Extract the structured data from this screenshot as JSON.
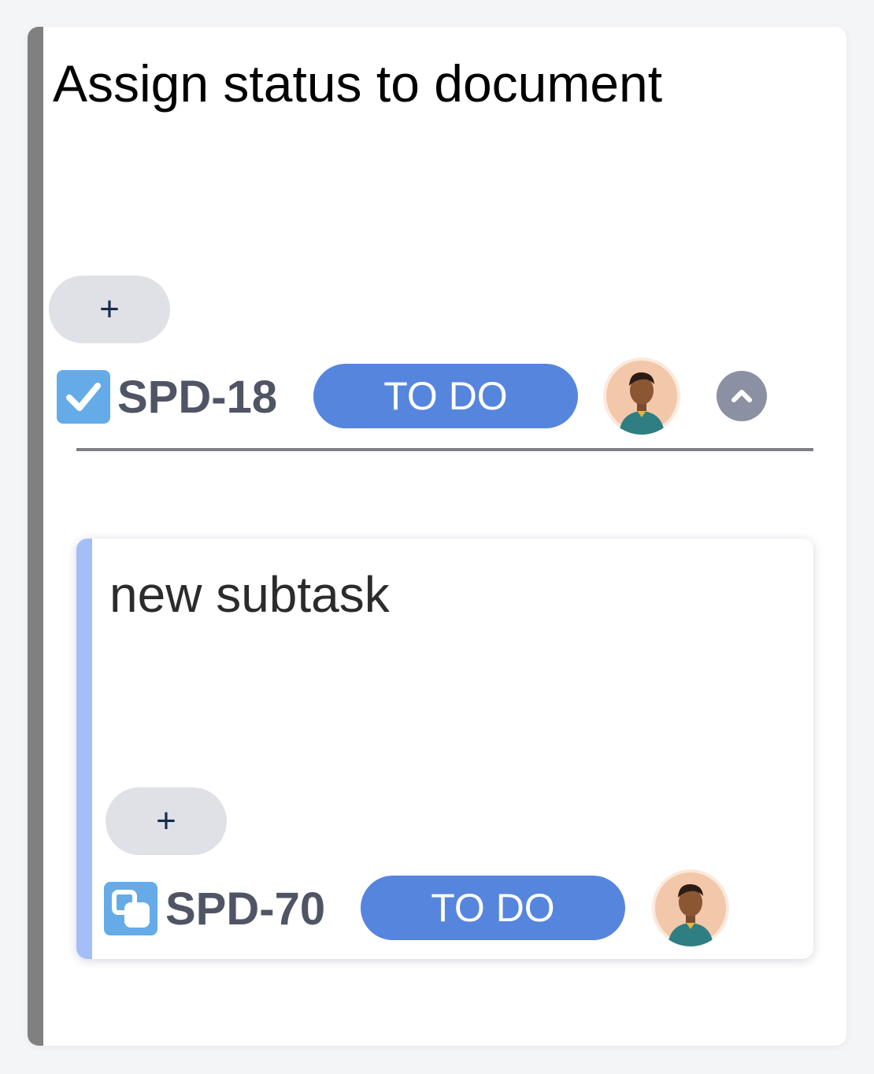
{
  "card": {
    "title": "Assign status to document",
    "add_label": "+",
    "issue": {
      "type_icon": "checkbox-icon",
      "key": "SPD-18",
      "status": "TO DO",
      "assignee_avatar": "avatar-icon",
      "collapse_icon": "chevron-up-icon"
    }
  },
  "subtask": {
    "title": "new subtask",
    "add_label": "+",
    "issue": {
      "type_icon": "subtask-icon",
      "key": "SPD-70",
      "status": "TO DO",
      "assignee_avatar": "avatar-icon"
    }
  },
  "colors": {
    "page_bg": "#f4f5f7",
    "card_accent": "#808080",
    "subtask_accent": "#a4bff8",
    "status_pill": "#5685de",
    "type_icon": "#65abe8",
    "add_button": "#dfe1e6",
    "issue_key": "#505565",
    "collapse_button": "#8b91a2"
  }
}
